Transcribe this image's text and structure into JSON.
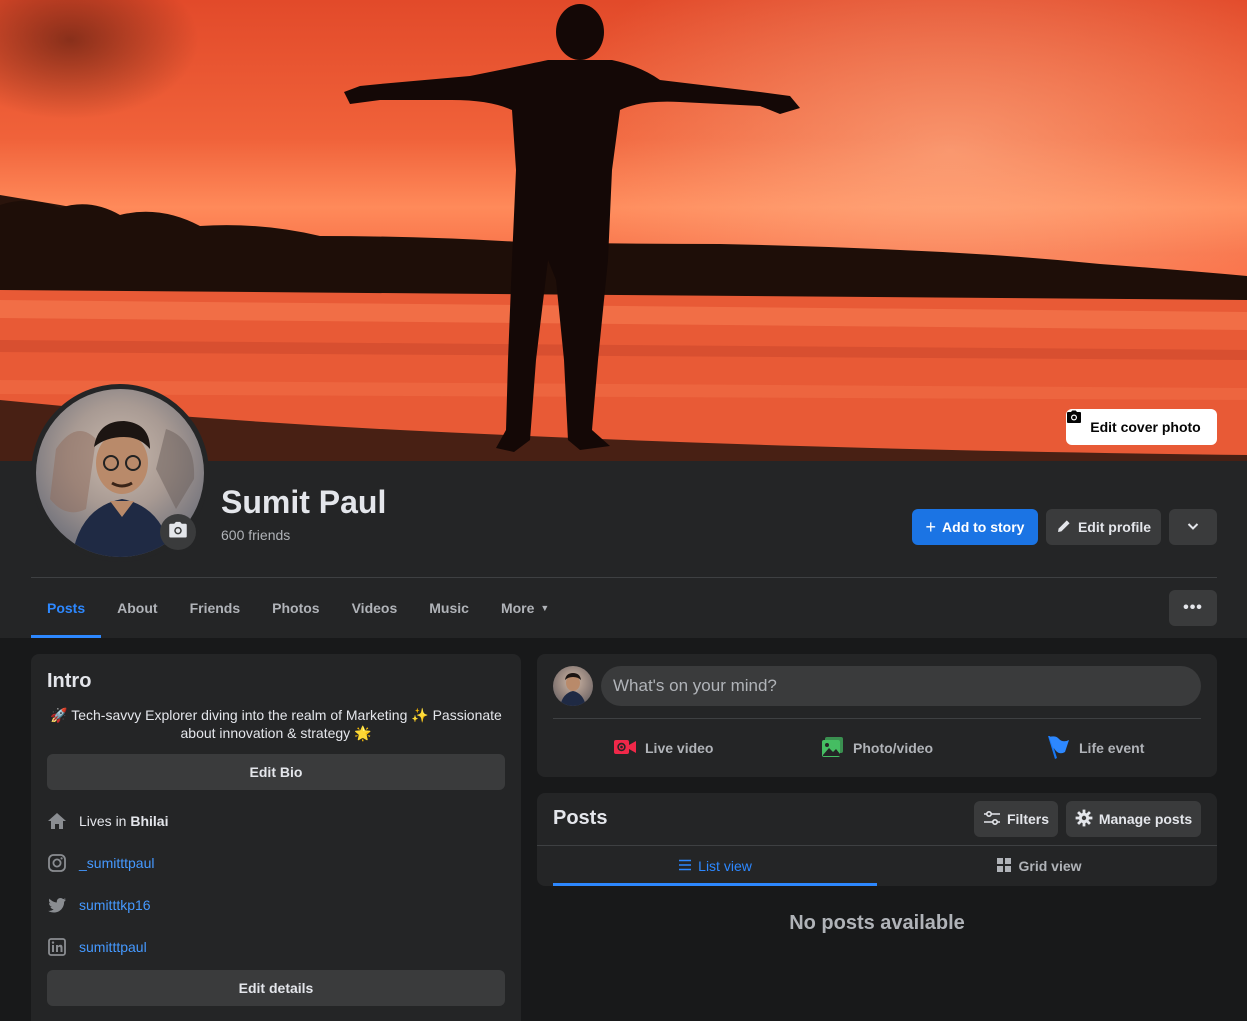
{
  "cover": {
    "edit_label": "Edit cover photo"
  },
  "profile": {
    "name": "Sumit Paul",
    "friends": "600 friends",
    "add_story_label": "Add to story",
    "edit_profile_label": "Edit profile"
  },
  "tabs": [
    {
      "label": "Posts",
      "active": true
    },
    {
      "label": "About"
    },
    {
      "label": "Friends"
    },
    {
      "label": "Photos"
    },
    {
      "label": "Videos"
    },
    {
      "label": "Music"
    },
    {
      "label": "More"
    }
  ],
  "intro": {
    "title": "Intro",
    "bio_line1": "🚀 Tech-savvy Explorer diving into the realm of Marketing ✨ Passionate",
    "bio_line2": "about innovation & strategy 🌟",
    "edit_bio_label": "Edit Bio",
    "lives_prefix": "Lives in",
    "lives_city": "Bhilai",
    "instagram": "_sumitttpaul",
    "twitter": "sumitttkp16",
    "linkedin": "sumitttpaul",
    "edit_details_label": "Edit details"
  },
  "composer": {
    "placeholder": "What's on your mind?",
    "live_video": "Live video",
    "photo_video": "Photo/video",
    "life_event": "Life event"
  },
  "posts": {
    "title": "Posts",
    "filters_label": "Filters",
    "manage_label": "Manage posts",
    "list_view": "List view",
    "grid_view": "Grid view",
    "empty_text": "No posts available"
  },
  "colors": {
    "accent": "#2d88ff",
    "primary_button": "#1b74e4",
    "card": "#242526",
    "background": "#18191a"
  }
}
